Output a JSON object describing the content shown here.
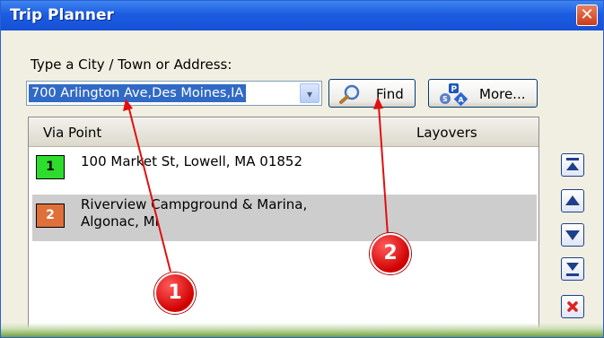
{
  "window": {
    "title": "Trip Planner",
    "close_glyph": "✕"
  },
  "search": {
    "prompt": "Type a City / Town or Address:",
    "value": "700 Arlington Ave,Des Moines,IA",
    "dropdown_glyph": "▾",
    "find_label": "Find",
    "more_label": "More..."
  },
  "list": {
    "headers": {
      "via_point": "Via Point",
      "layovers": "Layovers"
    },
    "rows": [
      {
        "number": "1",
        "text": "100 Market St, Lowell, MA 01852",
        "badge_color": "#2ddc2d"
      },
      {
        "number": "2",
        "text_line1": "Riverview Campground & Marina,",
        "text_line2": "Algonac, MI",
        "badge_color": "#e0703a"
      }
    ]
  },
  "side_buttons": [
    {
      "icon": "move-to-top-icon"
    },
    {
      "icon": "move-up-icon"
    },
    {
      "icon": "move-down-icon"
    },
    {
      "icon": "move-to-bottom-icon"
    },
    {
      "icon": "delete-icon"
    }
  ],
  "callouts": [
    {
      "label": "1"
    },
    {
      "label": "2"
    }
  ],
  "colors": {
    "titlebar": "#1c5ce0",
    "selection": "#316ac5",
    "callout_red": "#d00000"
  }
}
